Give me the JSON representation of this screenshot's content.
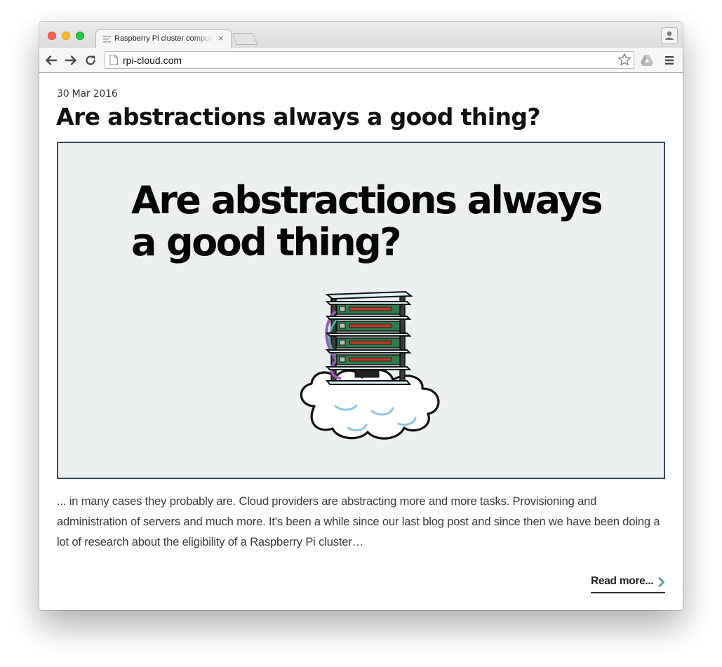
{
  "browser": {
    "tab_title": "Raspberry Pi cluster computing",
    "tab_close": "×",
    "url": "rpi-cloud.com",
    "icons": [
      "back-arrow-icon",
      "forward-arrow-icon",
      "reload-icon",
      "page-icon",
      "bookmark-star-icon",
      "google-drive-icon",
      "menu-icon",
      "profile-icon"
    ]
  },
  "post": {
    "date": "30 Mar 2016",
    "title": "Are abstractions always a good thing?",
    "hero_text": "Are abstractions always a good thing?",
    "excerpt": "... in many cases they probably are. Cloud providers are abstracting more and more tasks. Provisioning and administration of servers and much more. It's been a while since our last blog post and since then we have been doing a lot of research about the eligibility of a Raspberry Pi cluster…",
    "read_more": "Read more...",
    "colors": {
      "hero_background": "#ecf0f1",
      "hero_border": "#34495e",
      "chevron": "#5a9aa6"
    }
  }
}
